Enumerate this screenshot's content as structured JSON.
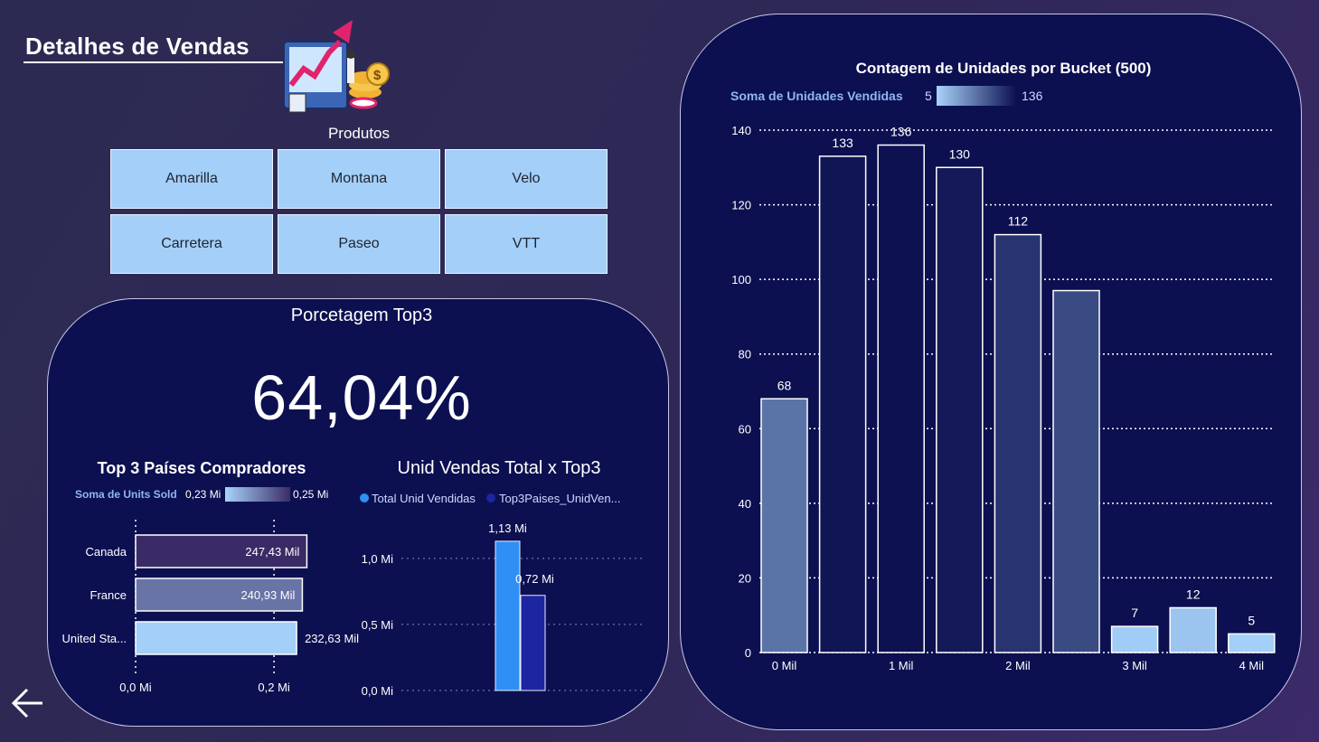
{
  "header": {
    "title": "Detalhes de Vendas",
    "products_label": "Produtos"
  },
  "products": {
    "buttons": [
      "Amarilla",
      "Montana",
      "Velo",
      "Carretera",
      "Paseo",
      "VTT"
    ]
  },
  "kpi": {
    "title": "Porcetagem Top3",
    "value": "64,04%"
  },
  "colors": {
    "background": "#2f2857",
    "panel": "#0c1050",
    "slicer": "#a3cff8",
    "total_series": "#2f8ff5",
    "top3_series": "#1e25a0"
  },
  "icons": {
    "hero": "sales-growth-illustration-icon",
    "back": "arrow-left-icon"
  },
  "chart_data": [
    {
      "type": "bar",
      "orientation": "horizontal",
      "title": "Top 3 Países Compradores",
      "categories": [
        "Canada",
        "France",
        "United Sta..."
      ],
      "values": [
        247.43,
        240.93,
        232.63
      ],
      "unit": "Mil",
      "data_labels": [
        "247,43 Mil",
        "240,93 Mil",
        "232,63 Mil"
      ],
      "x_ticks": [
        "0,0 Mi",
        "0,2 Mi"
      ],
      "x_tick_values": [
        0,
        0.2
      ],
      "xlim": [
        0,
        0.29
      ],
      "color_legend": {
        "label": "Soma de Units Sold",
        "min": "0,23 Mi",
        "max": "0,25 Mi"
      }
    },
    {
      "type": "bar",
      "title": "Unid Vendas Total x Top3",
      "series": [
        {
          "name": "Total Unid Vendidas",
          "values": [
            1.13
          ],
          "label": "1,13 Mi",
          "color": "#2f8ff5"
        },
        {
          "name": "Top3Paises_UnidVen...",
          "values": [
            0.72
          ],
          "label": "0,72 Mi",
          "color": "#1e25a0"
        }
      ],
      "y_ticks": [
        "0,0 Mi",
        "0,5 Mi",
        "1,0 Mi"
      ],
      "y_tick_values": [
        0,
        0.5,
        1.0
      ],
      "ylim": [
        0,
        1.3
      ],
      "legend_position": "top-left",
      "grid": true
    },
    {
      "type": "bar",
      "title": "Contagem de Unidades por Bucket (500)",
      "x": [
        0,
        500,
        1000,
        1500,
        2000,
        2500,
        3000,
        3500,
        4000
      ],
      "values": [
        68,
        133,
        136,
        130,
        112,
        97,
        7,
        12,
        5
      ],
      "data_labels": [
        "68",
        "133",
        "136",
        "130",
        "112",
        "",
        "7",
        "12",
        "5"
      ],
      "x_ticks": [
        "0 Mil",
        "1 Mil",
        "2 Mil",
        "3 Mil",
        "4 Mil"
      ],
      "y_ticks": [
        "0",
        "20",
        "40",
        "60",
        "80",
        "100",
        "120",
        "140"
      ],
      "y_tick_values": [
        0,
        20,
        40,
        60,
        80,
        100,
        120,
        140
      ],
      "ylim": [
        0,
        140
      ],
      "grid": true,
      "color_legend": {
        "label": "Soma de Unidades Vendidas",
        "min": "5",
        "max": "136"
      }
    }
  ]
}
